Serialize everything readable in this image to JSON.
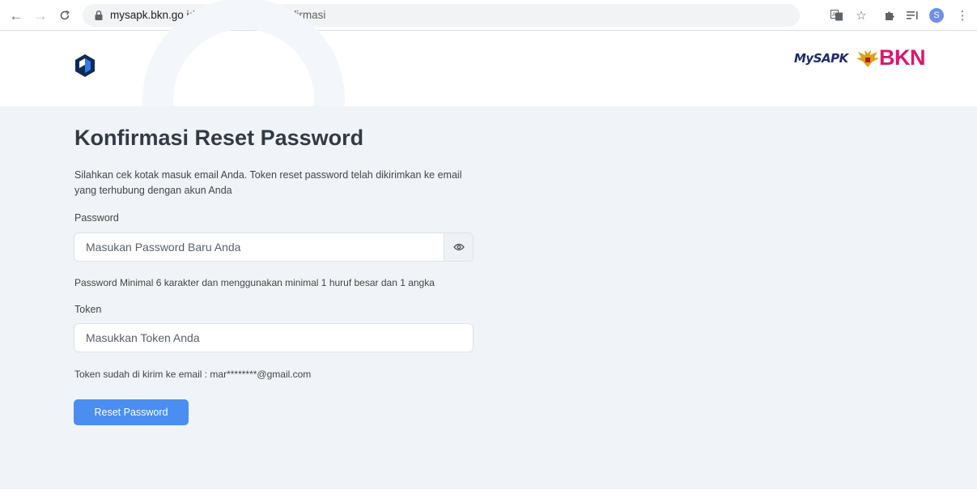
{
  "browser": {
    "url_host": "mysapk.bkn.go.id",
    "url_path": "/reset-password/konfirmasi",
    "profile_initial": "S"
  },
  "header": {
    "brand_mysapk": "MySAPK",
    "brand_bkn": "BKN"
  },
  "form": {
    "title": "Konfirmasi Reset Password",
    "intro": "Silahkan cek kotak masuk email Anda. Token reset password telah dikirimkan ke email yang terhubung dengan akun Anda",
    "password_label": "Password",
    "password_placeholder": "Masukan Password Baru Anda",
    "password_hint": "Password Minimal 6 karakter dan menggunakan minimal 1 huruf besar dan 1 angka",
    "token_label": "Token",
    "token_placeholder": "Masukkan Token Anda",
    "token_hint": "Token sudah di kirim ke email : mar********@gmail.com",
    "submit_label": "Reset Password"
  },
  "colors": {
    "primary": "#4a8ef2",
    "page_bg": "#f0f4f9",
    "bkn_brand": "#d6186f",
    "mysapk_brand": "#1f2a6b"
  }
}
